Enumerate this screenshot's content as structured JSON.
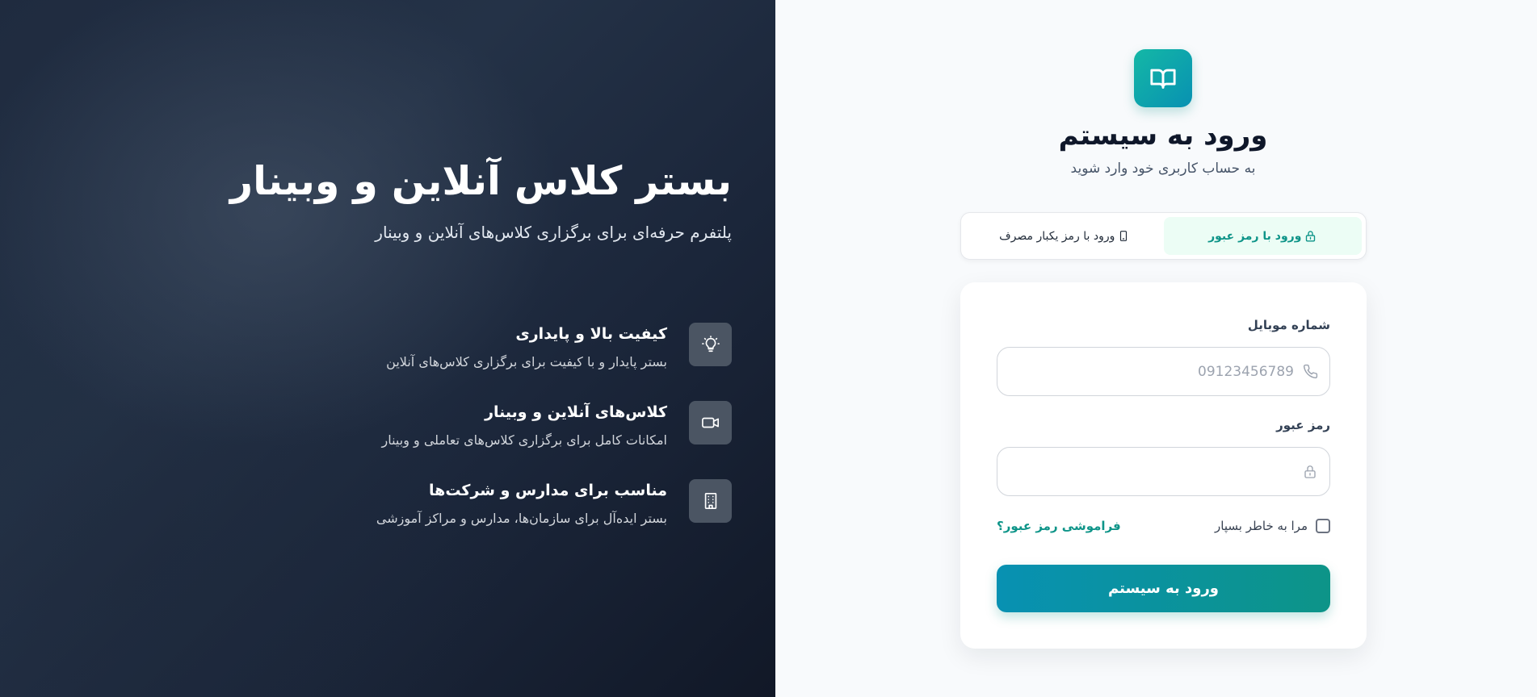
{
  "hero": {
    "title": "بستر کلاس آنلاین و وبینار",
    "subtitle": "پلتفرم حرفه‌ای برای برگزاری کلاس‌های آنلاین و وبینار",
    "features": [
      {
        "icon": "lightbulb-icon",
        "title": "کیفیت بالا و پایداری",
        "desc": "بستر پایدار و با کیفیت برای برگزاری کلاس‌های آنلاین"
      },
      {
        "icon": "video-camera-icon",
        "title": "کلاس‌های آنلاین و وبینار",
        "desc": "امکانات کامل برای برگزاری کلاس‌های تعاملی و وبینار"
      },
      {
        "icon": "building-icon",
        "title": "مناسب برای مدارس و شرکت‌ها",
        "desc": "بستر ایده‌آل برای سازمان‌ها، مدارس و مراکز آموزشی"
      }
    ]
  },
  "login": {
    "logo_icon": "open-book-icon",
    "title": "ورود به سیستم",
    "subtitle": "به حساب کاربری خود وارد شوید",
    "tabs": [
      {
        "label": "ورود با رمز عبور",
        "icon": "lock-icon",
        "active": true
      },
      {
        "label": "ورود با رمز یکبار مصرف",
        "icon": "mobile-phone-icon",
        "active": false
      }
    ],
    "mobile": {
      "label": "شماره موبایل",
      "placeholder": "09123456789",
      "value": "",
      "icon": "phone-icon"
    },
    "password": {
      "label": "رمز عبور",
      "placeholder": "",
      "value": "",
      "icon": "lock-icon"
    },
    "remember_label": "مرا به خاطر بسپار",
    "remember_checked": false,
    "forgot_label": "فراموشی رمز عبور؟",
    "submit_label": "ورود به سیستم"
  },
  "colors": {
    "accent": "#0d9488",
    "accent_light": "#ecfdf5",
    "button_gradient_start": "#0d9488",
    "button_gradient_end": "#0891b2",
    "hero_background": "#1e293b"
  }
}
